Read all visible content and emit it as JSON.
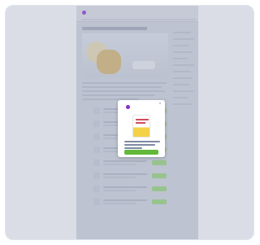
{
  "page": {
    "brand": "",
    "blurred": true,
    "modal_visible": true
  },
  "colors": {
    "brand_purple": "#7a1fb8",
    "cta_green": "#63b83a",
    "row_button_green": "#8fcf74",
    "book_yellow": "#f3d247",
    "book_red": "#d44b5b"
  },
  "icons": {
    "logo": "brand-logo-icon",
    "close": "close-icon",
    "book": "ebook-cover-icon"
  }
}
